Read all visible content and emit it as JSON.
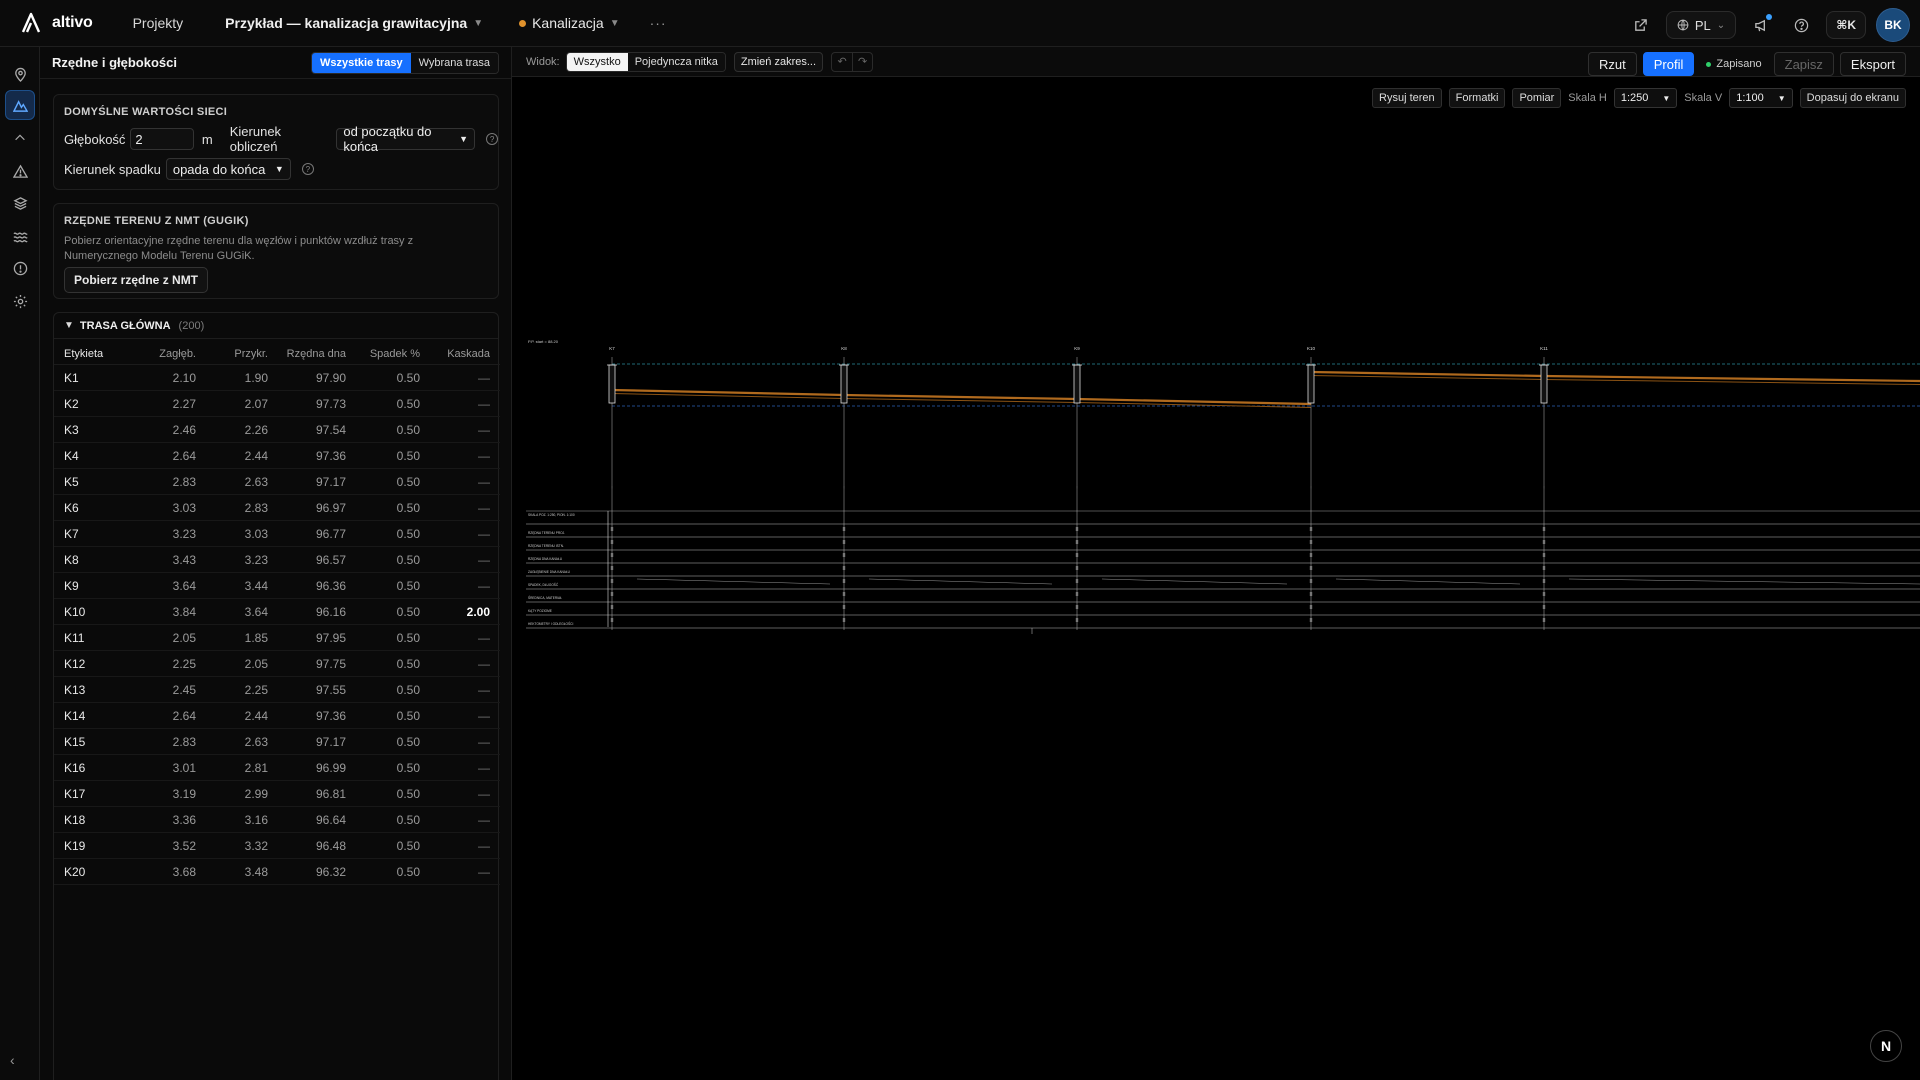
{
  "app": {
    "name": "altivo"
  },
  "topbar": {
    "nav_projects": "Projekty",
    "project_name": "Przykład — kanalizacja grawitacyjna",
    "network_name": "Kanalizacja",
    "more": "···",
    "lang": "PL",
    "shortcut": "⌘K",
    "user_initials": "BK"
  },
  "panel": {
    "title": "Rzędne i głębokości",
    "scope_all": "Wszystkie trasy",
    "scope_selected": "Wybrana trasa",
    "defaults": {
      "title": "DOMYŚLNE WARTOŚCI SIECI",
      "depth_label": "Głębokość",
      "depth_value": "2",
      "depth_unit": "m",
      "calc_dir_label": "Kierunek obliczeń",
      "calc_dir_value": "od początku do końca",
      "slope_dir_label": "Kierunek spadku",
      "slope_dir_value": "opada do końca"
    },
    "terrain": {
      "title": "RZĘDNE TERENU Z NMT (GUGIK)",
      "description": "Pobierz orientacyjne rzędne terenu dla węzłów i punktów wzdłuż trasy z Numerycznego Modelu Terenu GUGiK.",
      "button": "Pobierz rzędne z NMT"
    },
    "route": {
      "title": "TRASA GŁÓWNA",
      "count": "(200)",
      "columns": [
        "Etykieta",
        "Zagłęb.",
        "Przykr.",
        "Rzędna dna",
        "Spadek %",
        "Kaskada"
      ],
      "rows": [
        [
          "K1",
          "2.10",
          "1.90",
          "97.90",
          "0.50",
          "—"
        ],
        [
          "K2",
          "2.27",
          "2.07",
          "97.73",
          "0.50",
          "—"
        ],
        [
          "K3",
          "2.46",
          "2.26",
          "97.54",
          "0.50",
          "—"
        ],
        [
          "K4",
          "2.64",
          "2.44",
          "97.36",
          "0.50",
          "—"
        ],
        [
          "K5",
          "2.83",
          "2.63",
          "97.17",
          "0.50",
          "—"
        ],
        [
          "K6",
          "3.03",
          "2.83",
          "96.97",
          "0.50",
          "—"
        ],
        [
          "K7",
          "3.23",
          "3.03",
          "96.77",
          "0.50",
          "—"
        ],
        [
          "K8",
          "3.43",
          "3.23",
          "96.57",
          "0.50",
          "—"
        ],
        [
          "K9",
          "3.64",
          "3.44",
          "96.36",
          "0.50",
          "—"
        ],
        [
          "K10",
          "3.84",
          "3.64",
          "96.16",
          "0.50",
          "2.00"
        ],
        [
          "K11",
          "2.05",
          "1.85",
          "97.95",
          "0.50",
          "—"
        ],
        [
          "K12",
          "2.25",
          "2.05",
          "97.75",
          "0.50",
          "—"
        ],
        [
          "K13",
          "2.45",
          "2.25",
          "97.55",
          "0.50",
          "—"
        ],
        [
          "K14",
          "2.64",
          "2.44",
          "97.36",
          "0.50",
          "—"
        ],
        [
          "K15",
          "2.83",
          "2.63",
          "97.17",
          "0.50",
          "—"
        ],
        [
          "K16",
          "3.01",
          "2.81",
          "96.99",
          "0.50",
          "—"
        ],
        [
          "K17",
          "3.19",
          "2.99",
          "96.81",
          "0.50",
          "—"
        ],
        [
          "K18",
          "3.36",
          "3.16",
          "96.64",
          "0.50",
          "—"
        ],
        [
          "K19",
          "3.52",
          "3.32",
          "96.48",
          "0.50",
          "—"
        ],
        [
          "K20",
          "3.68",
          "3.48",
          "96.32",
          "0.50",
          "—"
        ]
      ]
    }
  },
  "toolbar": {
    "view_label": "Widok:",
    "view_all": "Wszystko",
    "view_single": "Pojedyncza nitka",
    "change_range": "Zmień zakres...",
    "plan": "Rzut",
    "profile": "Profil",
    "saved": "Zapisano",
    "save": "Zapisz",
    "export": "Eksport"
  },
  "drawing_tools": {
    "draw_terrain": "Rysuj teren",
    "formats": "Formatki",
    "measure": "Pomiar",
    "scale_h_label": "Skala H",
    "scale_h_value": "1:250",
    "scale_v_label": "Skala V",
    "scale_v_value": "1:100",
    "fit": "Dopasuj do ekranu"
  },
  "profile": {
    "nodes": [
      "K7",
      "K8",
      "K9",
      "K10",
      "K11"
    ],
    "ref_label": "P.P. start = 88.20",
    "table_rows": [
      "SKALA POZ. 1:250, PION. 1:100",
      "RZĘDNA TERENU PROJ.",
      "RZĘDNA TERENU ISTN.",
      "RZĘDNA DNA KANAŁU",
      "ZAGŁĘBIENIE DNA KANAŁU",
      "SPADEK, DŁUGOŚĆ",
      "ŚREDNICA, MATERIAŁ",
      "KĄTY POZIOME",
      "HEKTOMETRY I ODLEGŁOŚCI"
    ]
  },
  "colors": {
    "accent": "#1670ff",
    "pipe": "#b06a1e",
    "saved": "#2fcf6a"
  },
  "fab_label": "N"
}
